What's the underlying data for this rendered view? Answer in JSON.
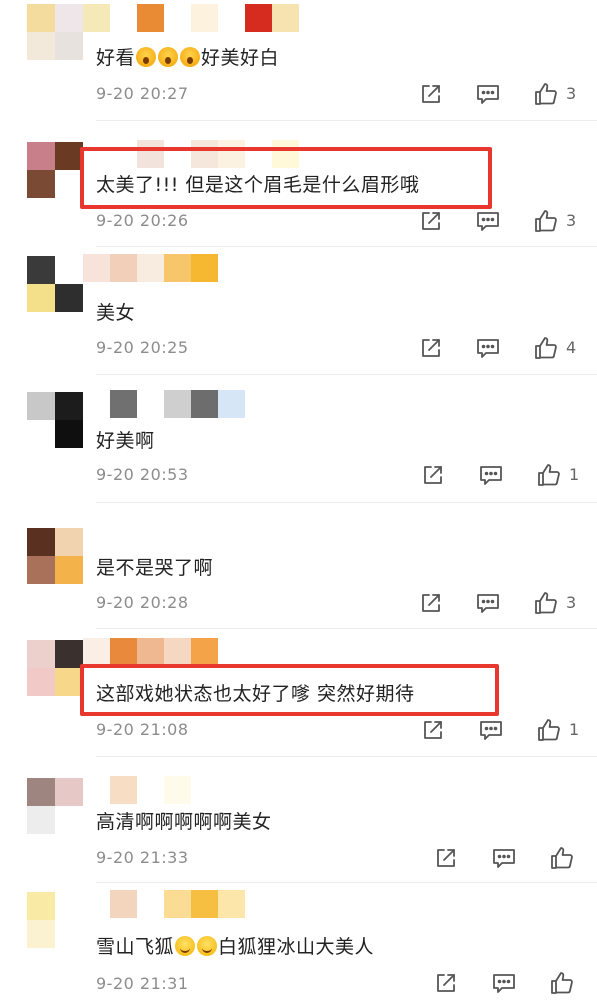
{
  "comments": [
    {
      "text": "好看",
      "emojis": [
        "scream",
        "scream",
        "scream"
      ],
      "text_after": "好美好白",
      "time": "9-20 20:27",
      "likes": "3",
      "avatar": [
        "#f3dc9e",
        "#efe6ea",
        "#f3e9db",
        "#e7e2dd"
      ],
      "name": [
        "#f6e9b8",
        "#ffffff",
        "#e98a34",
        "#ffffff",
        "#fdf2dd",
        "#ffffff",
        "#d62b1f",
        "#f6e3b0"
      ]
    },
    {
      "text": "太美了!!! 但是这个眉毛是什么眉形哦",
      "time": "9-20 20:26",
      "likes": "3",
      "avatar": [
        "#c97f8a",
        "#6b3a22",
        "#7a4a34",
        "#ffffff"
      ],
      "name": [
        "#ffffff",
        "#ffffff",
        "#f2e4dc",
        "#ffffff",
        "#f6e7dc",
        "#fbf2e2",
        "#ffffff",
        "#fff8d9"
      ]
    },
    {
      "text": "美女",
      "time": "9-20 20:25",
      "likes": "4",
      "avatar": [
        "#3a3a3a",
        "#ffffff",
        "#f4e08a",
        "#2e2e2e"
      ],
      "name": [
        "#f7e3d9",
        "#f2cfb8",
        "#f8ebe0",
        "#f7c66a",
        "#f6b830",
        "#ffffff",
        "#ffffff",
        "#ffffff"
      ]
    },
    {
      "text": "好美啊",
      "time": "9-20 20:53",
      "likes": "1",
      "avatar": [
        "#c8c8c8",
        "#1c1c1c",
        "#ffffff",
        "#0f0f0f"
      ],
      "name": [
        "#ffffff",
        "#707070",
        "#ffffff",
        "#cfcfcf",
        "#6d6d6d",
        "#d7e6f6",
        "#ffffff",
        "#ffffff"
      ]
    },
    {
      "text": "是不是哭了啊",
      "time": "9-20 20:28",
      "likes": "3",
      "avatar": [
        "#5a3020",
        "#f1d3b0",
        "#a9705a",
        "#f4b34a"
      ],
      "name": [
        "#ffffff",
        "#ffffff",
        "#ffffff",
        "#ffffff",
        "#ffffff",
        "#ffffff",
        "#ffffff",
        "#ffffff"
      ]
    },
    {
      "text": "这部戏她状态也太好了嗲 突然好期待",
      "time": "9-20 21:08",
      "likes": "1",
      "avatar": [
        "#ecd0cc",
        "#3a302e",
        "#f1c9c6",
        "#f7d88a"
      ],
      "name": [
        "#fbeee5",
        "#e9893c",
        "#f0b890",
        "#f6d7c2",
        "#f5a348",
        "#ffffff",
        "#ffffff",
        "#ffffff"
      ]
    },
    {
      "text": "高清啊啊啊啊啊美女",
      "time": "9-20 21:33",
      "likes": "",
      "avatar": [
        "#9e8580",
        "#e6c9c7",
        "#ededed",
        "#ffffff"
      ],
      "name": [
        "#ffffff",
        "#f7ddc3",
        "#ffffff",
        "#fffbea",
        "#ffffff",
        "#ffffff",
        "#ffffff",
        "#ffffff"
      ]
    },
    {
      "text": "雪山飞狐",
      "emojis": [
        "smile",
        "smile"
      ],
      "text_after": "白狐狸冰山大美人",
      "time": "9-20 21:31",
      "likes": "",
      "avatar": [
        "#f9eaa6",
        "#ffffff",
        "#fbf2d2",
        "#ffffff"
      ],
      "name": [
        "#ffffff",
        "#f3d5bd",
        "#ffffff",
        "#fbdc95",
        "#f7bf42",
        "#fde6a9",
        "#ffffff",
        "#ffffff"
      ]
    }
  ],
  "actions": {
    "share_icon": "share-icon",
    "comment_icon": "comment-icon",
    "like_icon": "thumbs-up-icon"
  },
  "colors": {
    "highlight": "#e8372f",
    "time": "#8c8c8c",
    "text": "#222222"
  }
}
